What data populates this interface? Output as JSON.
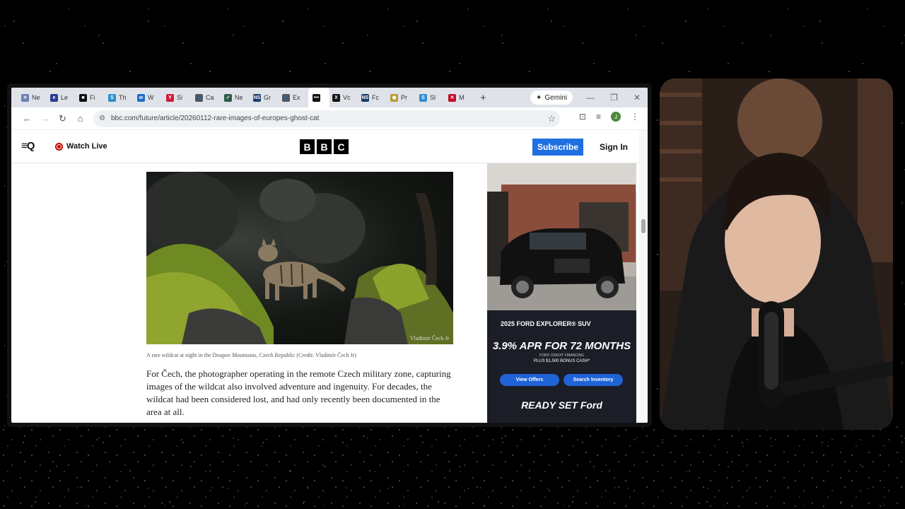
{
  "browser": {
    "tabs": [
      {
        "label": "Ne",
        "color": "#6a7fb0",
        "glyph": "✕"
      },
      {
        "label": "Le",
        "color": "#2a3b8f",
        "glyph": "e"
      },
      {
        "label": "Fi",
        "color": "#111111",
        "glyph": "■"
      },
      {
        "label": "Th",
        "color": "#2b8fd0",
        "glyph": "S"
      },
      {
        "label": "W",
        "color": "#1e6cc8",
        "glyph": "w"
      },
      {
        "label": "Si",
        "color": "#d01a3a",
        "glyph": "Y"
      },
      {
        "label": "Ca",
        "color": "#555555",
        "glyph": "🐾"
      },
      {
        "label": "Ne",
        "color": "#2d5d45",
        "glyph": "✓"
      },
      {
        "label": "Gr",
        "color": "#1d3b6b",
        "glyph": "NS"
      },
      {
        "label": "Ex",
        "color": "#555555",
        "glyph": "🐾"
      },
      {
        "label": "",
        "color": "#111111",
        "glyph": "•••",
        "active": true
      },
      {
        "label": "Vc",
        "color": "#111111",
        "glyph": "X"
      },
      {
        "label": "Fc",
        "color": "#1d3b6b",
        "glyph": "NS"
      },
      {
        "label": "Pr",
        "color": "#b89a30",
        "glyph": "◉"
      },
      {
        "label": "Sl",
        "color": "#2b8fd0",
        "glyph": "S"
      },
      {
        "label": "M",
        "color": "#c0102a",
        "glyph": "✕"
      }
    ],
    "gemini_label": "Gemini",
    "url": "bbc.com/future/article/20260112-rare-images-of-europes-ghost-cat",
    "profile_initial": "J"
  },
  "bbc": {
    "watch_live": "Watch Live",
    "logo": [
      "B",
      "B",
      "C"
    ],
    "subscribe": "Subscribe",
    "sign_in": "Sign In"
  },
  "article": {
    "photo_credit": "Vladimír Čech Jr",
    "caption": "A rare wildcat at night in the Doupov Mountains, Czech Republic (Credit: Vladimír Čech Jr)",
    "paragraph": "For Čech, the photographer operating in the remote Czech military zone, capturing images of the wildcat also involved adventure and ingenuity. For decades, the wildcat had been considered lost, and had only recently been documented in the area at all."
  },
  "ad": {
    "model": "2025 FORD EXPLORER® SUV",
    "apr": "3.9% APR FOR 72 MONTHS",
    "financing": "FORD CREDIT FINANCING",
    "cash": "PLUS $1,500 BONUS CASH*",
    "btn_offers": "View Offers",
    "btn_inventory": "Search Inventory",
    "slogan": "READY SET Ford"
  }
}
